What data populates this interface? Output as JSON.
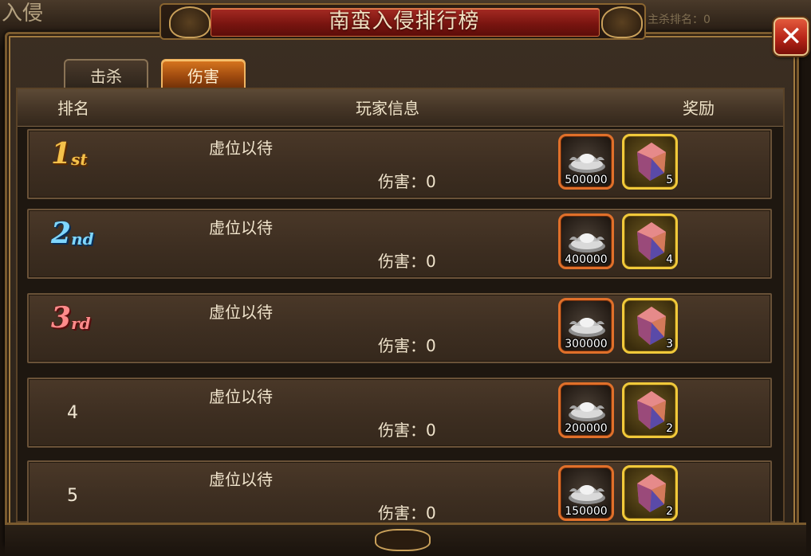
{
  "background": {
    "left_title": "入侵",
    "right_hint": "主杀排名：0"
  },
  "window": {
    "title": "南蛮入侵排行榜",
    "close_label": "✕"
  },
  "tabs": [
    {
      "label": "击杀",
      "active": false
    },
    {
      "label": "伤害",
      "active": true
    }
  ],
  "table": {
    "headers": {
      "rank": "排名",
      "player_info": "玩家信息",
      "reward": "奖励"
    },
    "rows": [
      {
        "rank": "1",
        "rank_suffix": "st",
        "player": "虚位以待",
        "damage": "伤害：0",
        "silver": "500000",
        "gem": "5"
      },
      {
        "rank": "2",
        "rank_suffix": "nd",
        "player": "虚位以待",
        "damage": "伤害：0",
        "silver": "400000",
        "gem": "4"
      },
      {
        "rank": "3",
        "rank_suffix": "rd",
        "player": "虚位以待",
        "damage": "伤害：0",
        "silver": "300000",
        "gem": "3"
      },
      {
        "rank": "4",
        "rank_suffix": "",
        "player": "虚位以待",
        "damage": "伤害：0",
        "silver": "200000",
        "gem": "2"
      },
      {
        "rank": "5",
        "rank_suffix": "",
        "player": "虚位以待",
        "damage": "伤害：0",
        "silver": "150000",
        "gem": "2"
      }
    ]
  },
  "colors": {
    "accent_orange": "#d8761f",
    "title_red": "#a52a23",
    "gold_border": "#f1c93a",
    "rank1": "#f4c14a",
    "rank2": "#7fd7ff",
    "rank3": "#ff8b8b"
  },
  "icons": {
    "silver": "silver-ingot-icon",
    "gem": "gem-crystal-icon",
    "close": "close-icon"
  }
}
